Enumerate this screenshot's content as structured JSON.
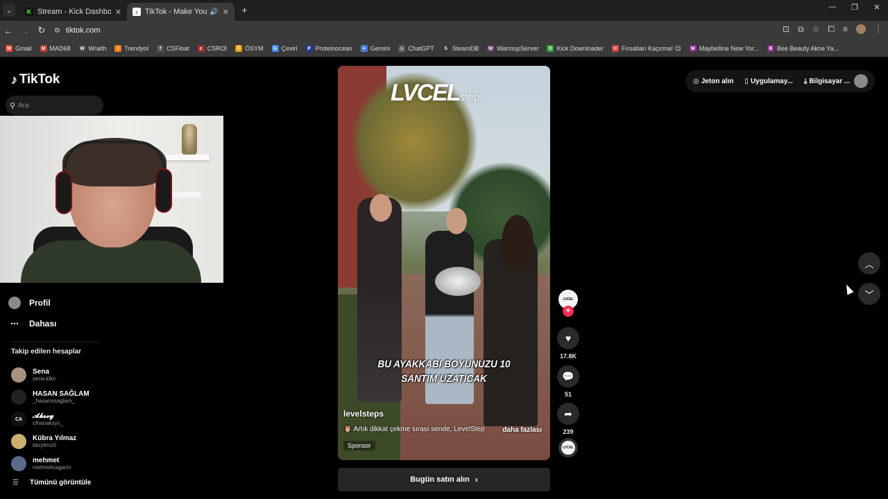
{
  "browser": {
    "tabs": [
      {
        "title": "Stream - Kick Dashboard",
        "favicon": "K",
        "favicon_color": "#53fc18",
        "active": false
      },
      {
        "title": "TikTok - Make Your Day",
        "favicon": "♪",
        "favicon_color": "#000000",
        "active": true
      }
    ],
    "url": "tiktok.com",
    "bookmarks": [
      {
        "label": "Gmail",
        "icon": "M",
        "color": "#ea4335"
      },
      {
        "label": "MAD68",
        "icon": "M",
        "color": "#c0392b"
      },
      {
        "label": "Wraith",
        "icon": "W",
        "color": "#444444"
      },
      {
        "label": "Trendyol",
        "icon": "t",
        "color": "#f27a1a"
      },
      {
        "label": "CSFloat",
        "icon": "f",
        "color": "#555555"
      },
      {
        "label": "CSROİ",
        "icon": "c",
        "color": "#a03030"
      },
      {
        "label": "ÖSYM",
        "icon": "Ö",
        "color": "#e39b00"
      },
      {
        "label": "Çeviri",
        "icon": "G",
        "color": "#4285f4"
      },
      {
        "label": "Proteinocean",
        "icon": "P",
        "color": "#1f3a93"
      },
      {
        "label": "Gemini",
        "icon": "✦",
        "color": "#4a7bd8"
      },
      {
        "label": "ChatGPT",
        "icon": "◎",
        "color": "#555555"
      },
      {
        "label": "SteamDB",
        "icon": "S",
        "color": "#333333"
      },
      {
        "label": "WarmupServer",
        "icon": "W",
        "color": "#6a3a6a"
      },
      {
        "label": "Kick Downloader",
        "icon": "D",
        "color": "#2d9d3a"
      },
      {
        "label": "Fırsatları Kaçırma! 😉",
        "icon": "✉",
        "color": "#d04040"
      },
      {
        "label": "Maybelline New Yor...",
        "icon": "M",
        "color": "#8a2a8a"
      },
      {
        "label": "Bee Beauty Akne Ya...",
        "icon": "B",
        "color": "#8a2a8a"
      }
    ]
  },
  "tiktok": {
    "logo": "TikTok",
    "search_placeholder": "Ara",
    "nav": [
      {
        "label": "Profil",
        "icon": "profile-icon"
      },
      {
        "label": "Dahası",
        "icon": "more-icon"
      }
    ],
    "following_header": "Takip edilen hesaplar",
    "following": [
      {
        "name": "Sena",
        "handle": "sena.klkn",
        "color": "#a89080"
      },
      {
        "name": "HASAN SAĞLAM",
        "handle": "_hasannsaglam_",
        "color": "#222222"
      },
      {
        "name": "𝓐𝓴𝓼𝓸𝔂",
        "handle": "cihanaksyx_",
        "color": "#111111",
        "initials": "CA"
      },
      {
        "name": "Kübra Yılmaz",
        "handle": "kbryilmz0",
        "color": "#c9b070"
      },
      {
        "name": "mehmet",
        "handle": "mehmetcagann",
        "color": "#5a6a8a"
      }
    ],
    "see_all": "Tümünü görüntüle",
    "video": {
      "brand_overlay": "LVCEL",
      "brand_overlay_sub": "step",
      "caption_overlay": "BU AYAKKABI BOYUNUZU 10 SANTIM UZATICAK",
      "author": "levelsteps",
      "description": "🦉 Artık dikkat çekme sırası sende, LevelStep",
      "more": "daha fazlası",
      "sponsor": "Sponsor"
    },
    "buy_button": "Bugün satın alın",
    "actions": {
      "avatar_label": "LVCEL",
      "likes": "17.8K",
      "comments": "51",
      "shares": "239"
    },
    "top_right": {
      "coins": "Jeton alın",
      "app": "Uygulamay...",
      "desktop": "Bilgisayar ..."
    }
  }
}
